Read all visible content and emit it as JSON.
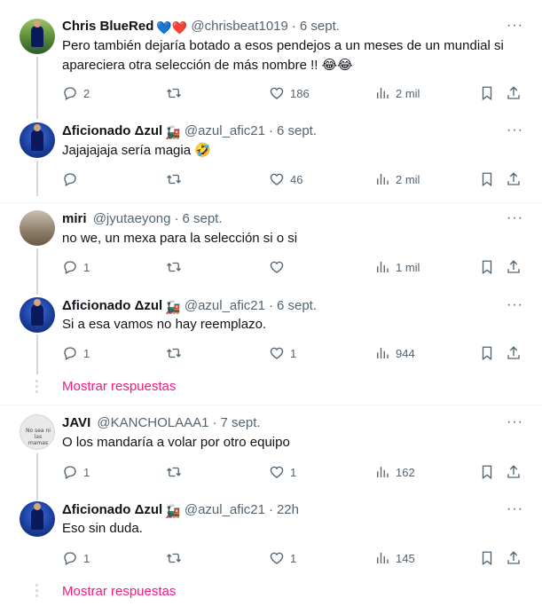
{
  "tweets": [
    {
      "name": "Chris BlueRed",
      "badges": "💙❤️",
      "handle": "@chrisbeat1019",
      "date": "6 sept.",
      "text": "Pero también dejaría botado a esos pendejos a un meses de un mundial si apareciera otra selección de más nombre !! 😂😂",
      "replies": "2",
      "retweets": "",
      "likes": "186",
      "views": "2 mil"
    },
    {
      "name": "Δficionado Δzul",
      "badges": "🚂",
      "handle": "@azul_afic21",
      "date": "6 sept.",
      "text": "Jajajajaja sería magia 🤣",
      "replies": "",
      "retweets": "",
      "likes": "46",
      "views": "2 mil"
    },
    {
      "name": "miri",
      "badges": "",
      "handle": "@jyutaeyong",
      "date": "6 sept.",
      "text": "no we, un mexa para la selección si o si",
      "replies": "1",
      "retweets": "",
      "likes": "",
      "views": "1 mil"
    },
    {
      "name": "Δficionado Δzul",
      "badges": "🚂",
      "handle": "@azul_afic21",
      "date": "6 sept.",
      "text": "Si a esa vamos no hay reemplazo.",
      "replies": "1",
      "retweets": "",
      "likes": "1",
      "views": "944"
    },
    {
      "name": "JAVI",
      "badges": "",
      "handle": "@KANCHOLAAA1",
      "date": "7 sept.",
      "text": "O los mandaría a volar por otro equipo",
      "replies": "1",
      "retweets": "",
      "likes": "1",
      "views": "162"
    },
    {
      "name": "Δficionado Δzul",
      "badges": "🚂",
      "handle": "@azul_afic21",
      "date": "22h",
      "text": "Eso sin duda.",
      "replies": "1",
      "retweets": "",
      "likes": "1",
      "views": "145"
    }
  ],
  "show_replies_label": "Mostrar respuestas",
  "more_icon": "···",
  "colors": {
    "accent": "#f91880",
    "muted": "#536471",
    "line": "#cfd9de"
  }
}
